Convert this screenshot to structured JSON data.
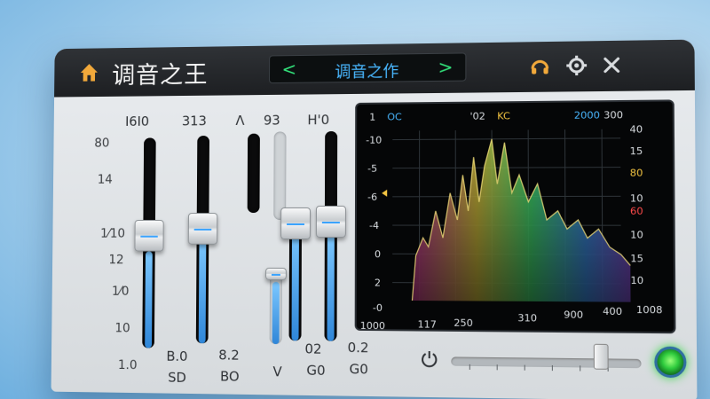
{
  "window": {
    "title": "调音之王"
  },
  "preset": {
    "name": "调音之作",
    "prev": "<",
    "next": ">"
  },
  "icons": {
    "home": "home-icon",
    "headphones": "headphones-icon",
    "settings": "gear-icon",
    "close": "close-icon",
    "power": "power-icon"
  },
  "faders": {
    "top_labels": [
      "I6I0",
      "313",
      "Λ",
      "93",
      "H'0"
    ],
    "scale_labels": [
      "80",
      "14",
      "1⁄10",
      "12",
      "1⁄0",
      "10",
      "1.0"
    ],
    "bottom_values": [
      "B.0",
      "8.2",
      "02",
      "0.2"
    ],
    "bottom_names": [
      "SD",
      "BO",
      "V",
      "G0",
      "G0"
    ],
    "levels": [
      0.62,
      0.6,
      0.3,
      0.66,
      0.52
    ]
  },
  "spectrum": {
    "header": [
      "1",
      "OC",
      "'02",
      "KC",
      "2000",
      "300"
    ],
    "right_labels": [
      "40",
      "15",
      "80",
      "10",
      "60",
      "10",
      "15",
      "10"
    ],
    "left_labels": [
      "-10",
      "-5",
      "-6",
      "-4",
      "0",
      "2",
      "-0"
    ],
    "freq_labels": [
      "1000",
      "117",
      "250",
      "310",
      "900",
      "400",
      "1008"
    ],
    "colors": {
      "accent_blue": "#49b7ff",
      "accent_yellow": "#f4c542",
      "accent_red": "#ff4b4b",
      "led_green": "#3bd94a"
    }
  }
}
